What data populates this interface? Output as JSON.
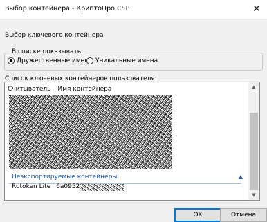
{
  "window": {
    "title": "Выбор контейнера - КриптоПро CSP",
    "close_glyph": "✕"
  },
  "dialog": {
    "section_label": "Выбор ключевого контейнера",
    "display_group": {
      "caption": "В списке показывать:",
      "options": [
        {
          "label": "Дружественные имена",
          "selected": true
        },
        {
          "label": "Уникальные имена",
          "selected": false
        }
      ]
    },
    "list_label": "Список ключевых контейнеров пользователя:",
    "list": {
      "columns": [
        "Считыватель",
        "Имя контейнера"
      ],
      "group": {
        "label": "Неэкспортируемые контейнеры",
        "collapse_glyph": "▲"
      },
      "rows": [
        {
          "reader": "Rutoken Lite",
          "container": "6a095238b-"
        }
      ],
      "scroll_up_glyph": "▲",
      "scroll_down_glyph": "▼"
    },
    "buttons": {
      "ok": "OK",
      "cancel": "Отмена"
    }
  }
}
